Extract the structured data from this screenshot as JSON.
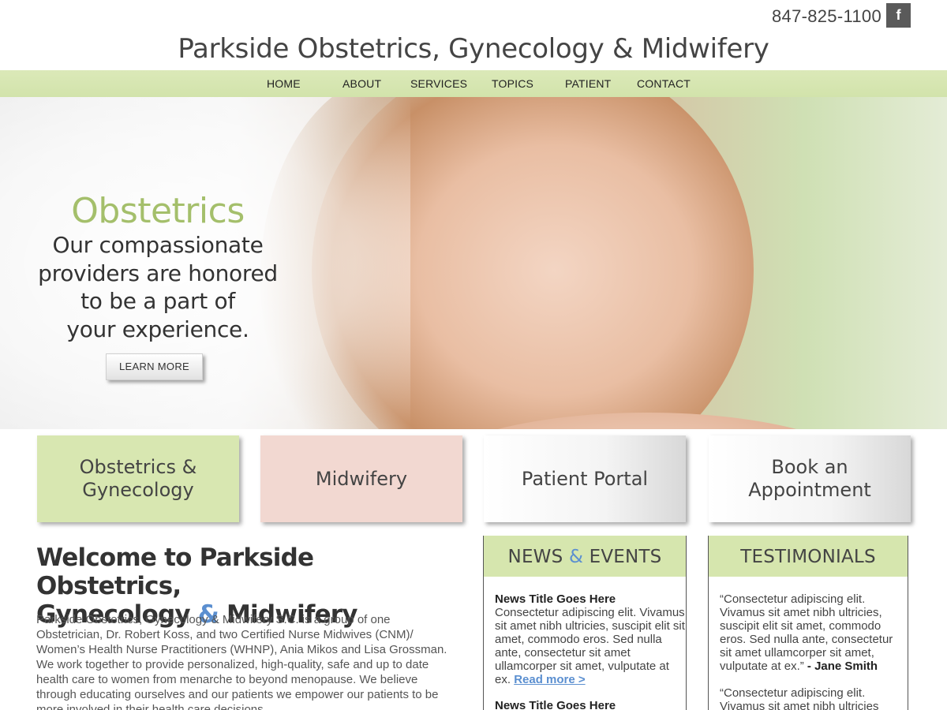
{
  "header": {
    "phone": "847-825-1100",
    "facebook_icon": "f",
    "site_title": "Parkside Obstetrics, Gynecology & Midwifery"
  },
  "nav": {
    "items": [
      "HOME",
      "ABOUT",
      "SERVICES",
      "TOPICS",
      "PATIENT",
      "CONTACT"
    ]
  },
  "hero": {
    "heading": "Obstetrics",
    "lines": [
      "Our compassionate",
      "providers are honored",
      "to be a part of",
      "your experience."
    ],
    "button": "LEARN MORE"
  },
  "tiles": [
    {
      "lines": [
        "Obstetrics &",
        "Gynecology"
      ]
    },
    {
      "lines": [
        "Midwifery"
      ]
    },
    {
      "lines": [
        "Patient Portal"
      ]
    },
    {
      "lines": [
        "Book an",
        "Appointment"
      ]
    }
  ],
  "welcome": {
    "title_line1": "Welcome to Parkside Obstetrics,",
    "title_line2_a": "Gynecology ",
    "title_line2_amp": "&",
    "title_line2_b": " Midwifery",
    "body": "Parkside Obstetrics, Gynecology & Midwifery S.C. is a group of one Obstetrician, Dr. Robert Koss, and two Certified Nurse Midwives (CNM)/ Women’s Health Nurse Practitioners (WHNP), Ania Mikos and Lisa Grossman. We work together to provide personalized, high-quality, safe and up to date health care to women from menarche to beyond menopause.  We believe through educating ourselves and our patients we empower our patients to be more involved in their health care decisions."
  },
  "news": {
    "title_a": "NEWS ",
    "title_amp": "&",
    "title_b": " EVENTS",
    "items": [
      {
        "title": "News Title Goes Here",
        "text": "Consectetur adipiscing elit. Vivamus sit amet nibh ultricies, suscipit elit sit amet, commodo eros. Sed nulla ante, consectetur sit amet ullamcorper sit amet, vulputate at ex. ",
        "link": "Read more >"
      },
      {
        "title": "News Title Goes Here",
        "text": "",
        "link": ""
      }
    ]
  },
  "testimonials": {
    "title": "TESTIMONIALS",
    "items": [
      {
        "quote": "“Consectetur adipiscing elit. Vivamus sit amet nibh ultricies, suscipit elit sit amet, commodo eros. Sed nulla ante, consectetur sit amet ullamcorper sit amet, vulputate at ex.” ",
        "author": "- Jane Smith"
      },
      {
        "quote": "“Consectetur adipiscing elit. Vivamus sit amet nibh ultricies",
        "author": ""
      }
    ]
  },
  "colors": {
    "accent_green": "#a4bf6b",
    "nav_green": "#d6e6ae",
    "accent_blue": "#5b8fd0",
    "tile_pink": "#f2d8d1"
  }
}
